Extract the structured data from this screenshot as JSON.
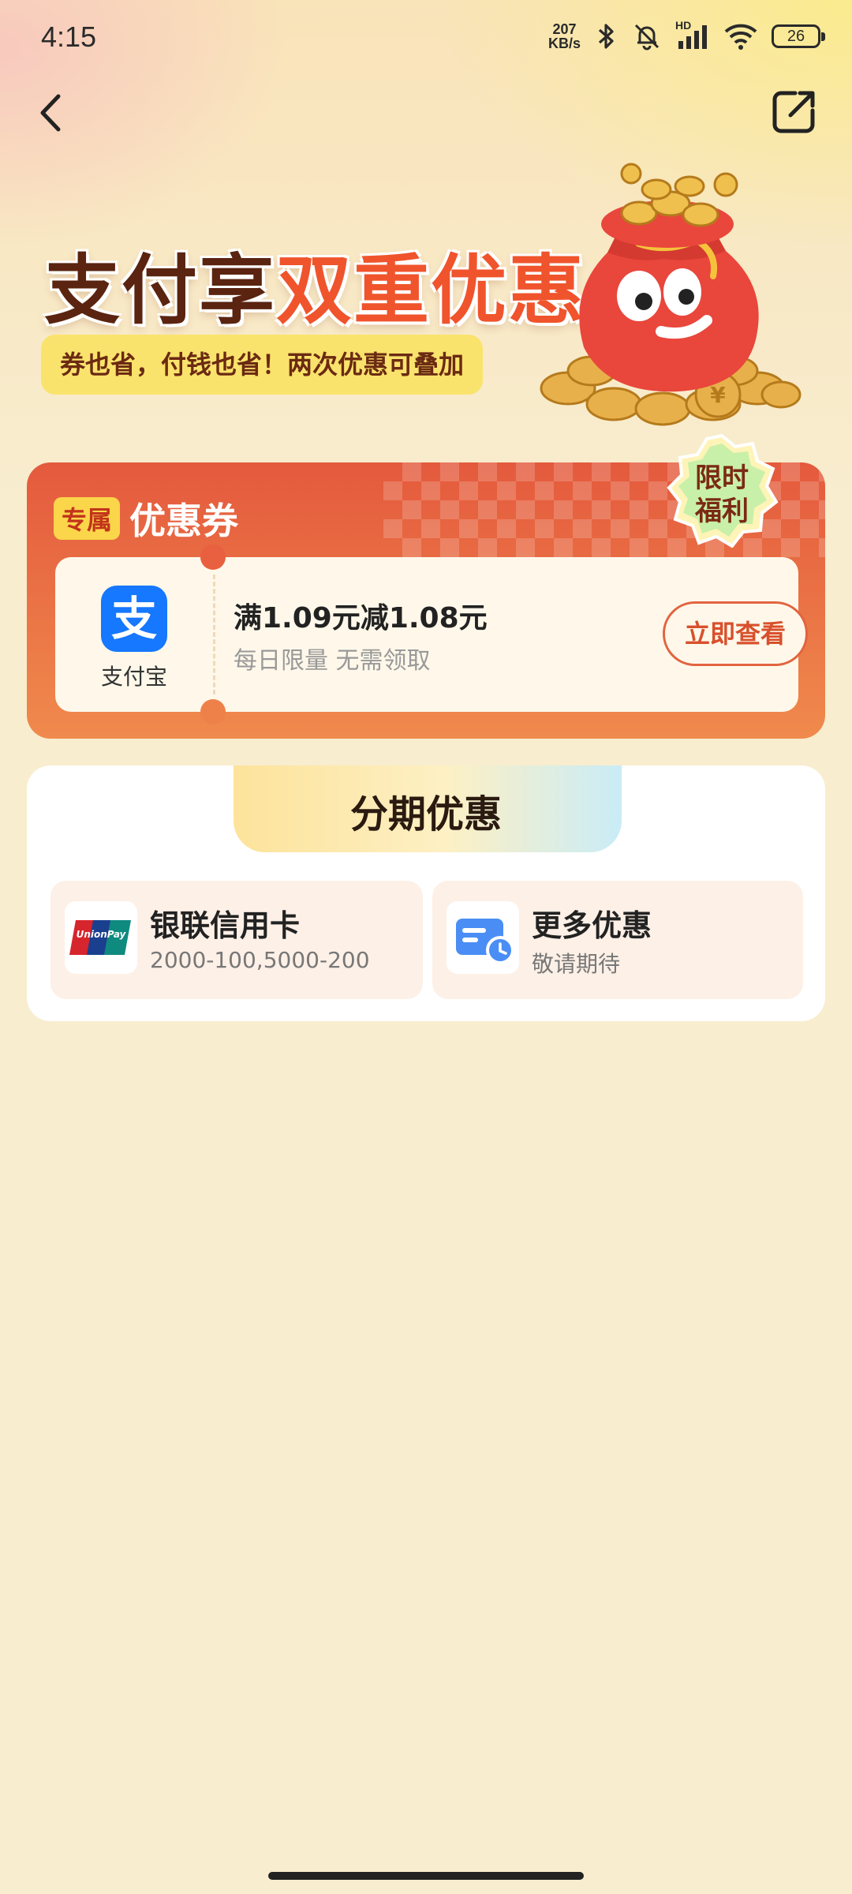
{
  "status_bar": {
    "time": "4:15",
    "net_speed_value": "207",
    "net_speed_unit": "KB/s",
    "signal_label": "HD",
    "battery": "26",
    "icons": [
      "bluetooth-icon",
      "mute-bell-icon",
      "signal-icon",
      "wifi-icon",
      "battery-icon"
    ]
  },
  "nav": {
    "back_icon": "chevron-left-icon",
    "share_icon": "share-icon"
  },
  "hero": {
    "title_part1": "支付享",
    "title_part2": "双重优惠",
    "subtitle": "券也省，付钱也省！两次优惠可叠加",
    "mascot": "money-bag-mascot"
  },
  "coupon_section": {
    "tag": "专属",
    "title": "优惠券",
    "badge_line1": "限时",
    "badge_line2": "福利",
    "coupon": {
      "logo_glyph": "支",
      "provider": "支付宝",
      "rule": "满1.09元减1.08元",
      "description": "每日限量 无需领取",
      "button": "立即查看"
    }
  },
  "installment_section": {
    "title": "分期优惠",
    "options": [
      {
        "title": "银联信用卡",
        "subtitle": "2000-100,5000-200",
        "icon": "unionpay-icon"
      },
      {
        "title": "更多优惠",
        "subtitle": "敬请期待",
        "icon": "card-clock-icon"
      }
    ]
  },
  "colors": {
    "background": "#f8edcf",
    "accent_red": "#e45a3d",
    "accent_orange": "#f08a4d",
    "alipay_blue": "#1677ff",
    "title_brown": "#5a2410"
  }
}
